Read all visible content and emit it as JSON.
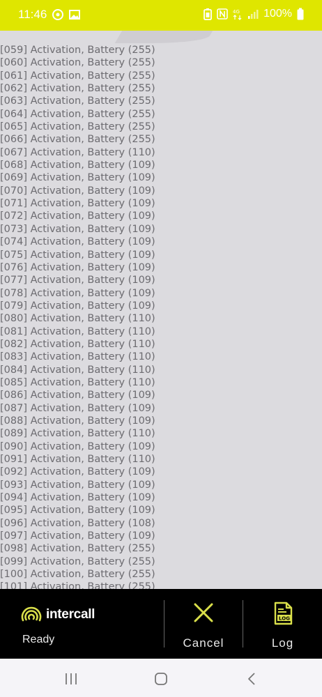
{
  "status_bar": {
    "time": "11:46",
    "battery_text": "100%",
    "background": "#dfe600"
  },
  "log": {
    "lines": [
      "[059] Activation, Battery (255)",
      "[060] Activation, Battery (255)",
      "[061] Activation, Battery (255)",
      "[062] Activation, Battery (255)",
      "[063] Activation, Battery (255)",
      "[064] Activation, Battery (255)",
      "[065] Activation, Battery (255)",
      "[066] Activation, Battery (255)",
      "[067] Activation, Battery (110)",
      "[068] Activation, Battery (109)",
      "[069] Activation, Battery (109)",
      "[070] Activation, Battery (109)",
      "[071] Activation, Battery (109)",
      "[072] Activation, Battery (109)",
      "[073] Activation, Battery (109)",
      "[074] Activation, Battery (109)",
      "[075] Activation, Battery (109)",
      "[076] Activation, Battery (109)",
      "[077] Activation, Battery (109)",
      "[078] Activation, Battery (109)",
      "[079] Activation, Battery (109)",
      "[080] Activation, Battery (110)",
      "[081] Activation, Battery (110)",
      "[082] Activation, Battery (110)",
      "[083] Activation, Battery (110)",
      "[084] Activation, Battery (110)",
      "[085] Activation, Battery (110)",
      "[086] Activation, Battery (109)",
      "[087] Activation, Battery (109)",
      "[088] Activation, Battery (109)",
      "[089] Activation, Battery (110)",
      "[090] Activation, Battery (109)",
      "[091] Activation, Battery (110)",
      "[092] Activation, Battery (109)",
      "[093] Activation, Battery (109)",
      "[094] Activation, Battery (109)",
      "[095] Activation, Battery (109)",
      "[096] Activation, Battery (108)",
      "[097] Activation, Battery (109)",
      "[098] Activation, Battery (255)",
      "[099] Activation, Battery (255)",
      "[100] Activation, Battery (255)",
      "[101] Activation, Battery (255)"
    ]
  },
  "toolbar": {
    "brand": "intercall",
    "status": "Ready",
    "cancel_label": "Cancel",
    "log_label": "Log",
    "log_icon_text": "LOG",
    "accent": "#d9df4a",
    "icons": {
      "brand": "intercall-logo-icon",
      "cancel": "close-icon",
      "log": "log-document-icon"
    }
  },
  "nav": {
    "icons": [
      "recent-apps-icon",
      "home-icon",
      "back-icon"
    ]
  }
}
